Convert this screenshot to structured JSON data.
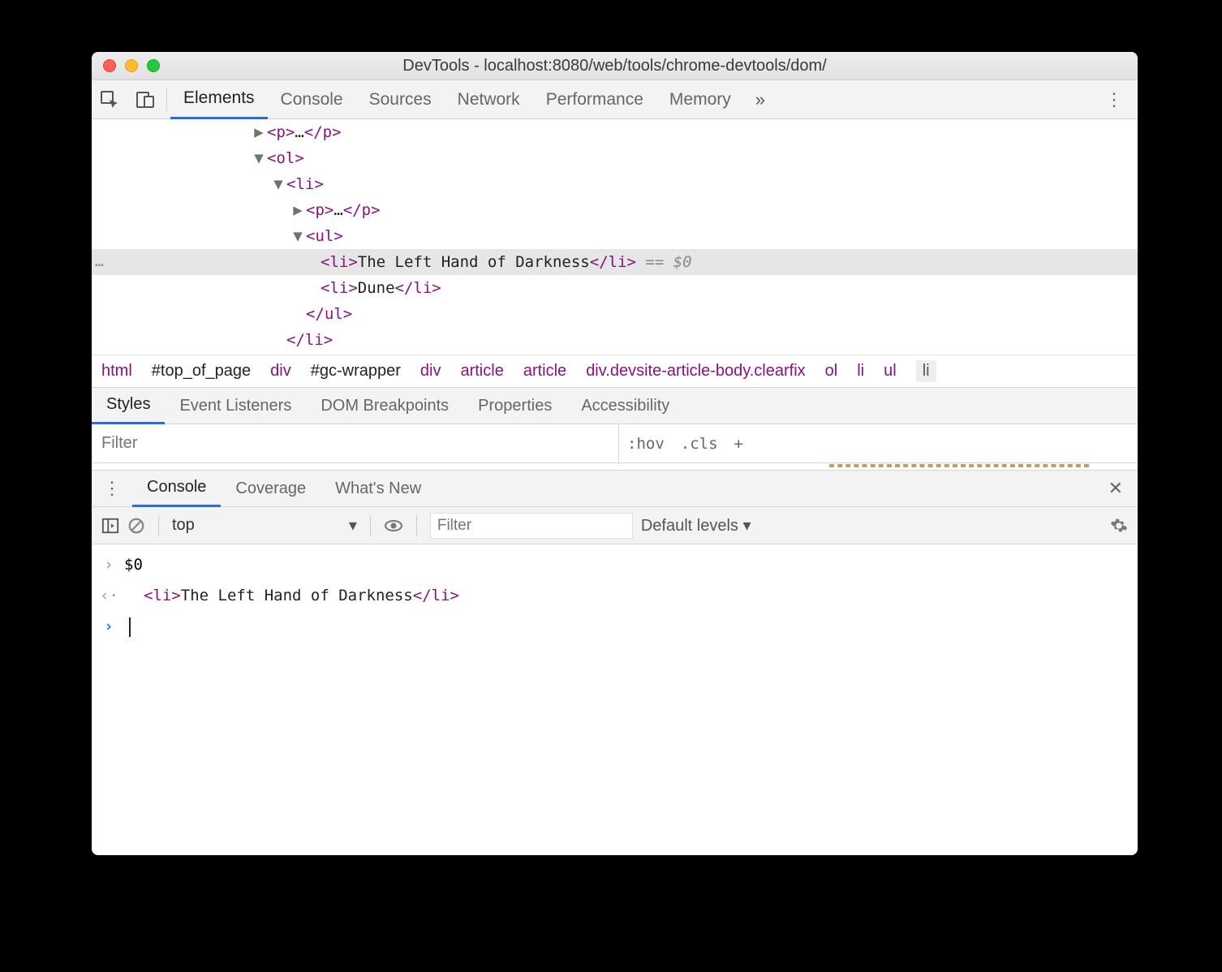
{
  "window": {
    "title": "DevTools - localhost:8080/web/tools/chrome-devtools/dom/"
  },
  "main_tabs": {
    "items": [
      "Elements",
      "Console",
      "Sources",
      "Network",
      "Performance",
      "Memory"
    ],
    "active": "Elements",
    "overflow_glyph": "»"
  },
  "dom_tree": {
    "rows": [
      {
        "indent": 198,
        "arrow": "▶",
        "open": "<p>",
        "mid": "…",
        "close": "</p>",
        "selected": false
      },
      {
        "indent": 198,
        "arrow": "▼",
        "open": "<ol>",
        "mid": "",
        "close": "",
        "selected": false
      },
      {
        "indent": 222,
        "arrow": "▼",
        "open": "<li>",
        "mid": "",
        "close": "",
        "selected": false
      },
      {
        "indent": 246,
        "arrow": "▶",
        "open": "<p>",
        "mid": "…",
        "close": "</p>",
        "selected": false
      },
      {
        "indent": 246,
        "arrow": "▼",
        "open": "<ul>",
        "mid": "",
        "close": "",
        "selected": false
      },
      {
        "indent": 282,
        "arrow": "",
        "open": "<li>",
        "mid": "The Left Hand of Darkness",
        "close": "</li>",
        "selected": true,
        "after": " == $0"
      },
      {
        "indent": 282,
        "arrow": "",
        "open": "<li>",
        "mid": "Dune",
        "close": "</li>",
        "selected": false
      },
      {
        "indent": 264,
        "arrow": "",
        "open": "</ul>",
        "mid": "",
        "close": "",
        "selected": false
      },
      {
        "indent": 240,
        "arrow": "",
        "open": "</li>",
        "mid": "",
        "close": "",
        "selected": false
      }
    ],
    "gutter_dots": "…"
  },
  "breadcrumb": [
    {
      "label": "html",
      "style": "tag"
    },
    {
      "label": "#top_of_page",
      "style": "black"
    },
    {
      "label": "div",
      "style": "tag"
    },
    {
      "label": "#gc-wrapper",
      "style": "black"
    },
    {
      "label": "div",
      "style": "tag"
    },
    {
      "label": "article",
      "style": "tag"
    },
    {
      "label": "article",
      "style": "tag"
    },
    {
      "label": "div.devsite-article-body.clearfix",
      "style": "tag"
    },
    {
      "label": "ol",
      "style": "tag"
    },
    {
      "label": "li",
      "style": "tag"
    },
    {
      "label": "ul",
      "style": "tag"
    },
    {
      "label": "li",
      "style": "last"
    }
  ],
  "styles_tabs": {
    "items": [
      "Styles",
      "Event Listeners",
      "DOM Breakpoints",
      "Properties",
      "Accessibility"
    ],
    "active": "Styles"
  },
  "styles_toolbar": {
    "filter_placeholder": "Filter",
    "hov": ":hov",
    "cls": ".cls",
    "plus": "+"
  },
  "drawer_tabs": {
    "items": [
      "Console",
      "Coverage",
      "What's New"
    ],
    "active": "Console"
  },
  "console_toolbar": {
    "context": "top",
    "filter_placeholder": "Filter",
    "levels": "Default levels ▾"
  },
  "console_rows": [
    {
      "caret": "›",
      "caret_color": "grey",
      "text": "$0"
    },
    {
      "caret": "‹·",
      "caret_color": "grey",
      "html_open": "<li>",
      "html_text": "The Left Hand of Darkness",
      "html_close": "</li>"
    },
    {
      "caret": "›",
      "caret_color": "blue",
      "text": "",
      "cursor": true
    }
  ]
}
